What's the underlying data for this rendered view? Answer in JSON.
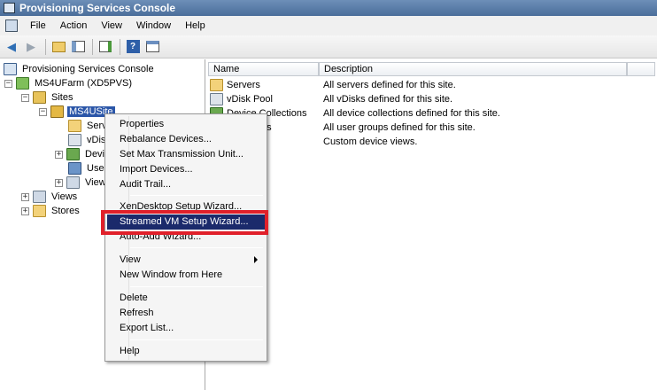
{
  "window": {
    "title": "Provisioning Services Console"
  },
  "menubar": {
    "items": [
      "File",
      "Action",
      "View",
      "Window",
      "Help"
    ]
  },
  "tree": {
    "root": "Provisioning Services Console",
    "farm": "MS4UFarm (XD5PVS)",
    "sites": "Sites",
    "site": "MS4USite",
    "site_children": [
      "Serv",
      "vDisk",
      "Devi",
      "User",
      "View"
    ],
    "views": "Views",
    "stores": "Stores"
  },
  "list": {
    "headers": {
      "name": "Name",
      "description": "Description"
    },
    "rows": [
      {
        "name": "Servers",
        "description": "All servers defined for this site."
      },
      {
        "name": "vDisk Pool",
        "description": "All vDisks defined for this site."
      },
      {
        "name": "Device Collections",
        "description": "All device collections defined for this site."
      },
      {
        "name": "ps",
        "description": "All user groups defined for this site."
      },
      {
        "name": "",
        "description": "Custom device views."
      }
    ]
  },
  "context_menu": {
    "items": [
      "Properties",
      "Rebalance Devices...",
      "Set Max Transmission Unit...",
      "Import Devices...",
      "Audit Trail...",
      "XenDesktop Setup Wizard...",
      "Streamed VM Setup Wizard...",
      "Auto-Add Wizard...",
      "View",
      "New Window from Here",
      "Delete",
      "Refresh",
      "Export List...",
      "Help"
    ],
    "highlighted": "Streamed VM Setup Wizard..."
  },
  "colors": {
    "highlight_box": "#e0202a",
    "menu_selection": "#1b2a6b",
    "tree_selection": "#2b56a8"
  }
}
